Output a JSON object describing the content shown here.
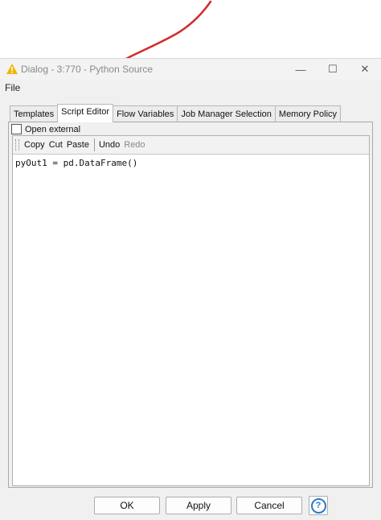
{
  "window": {
    "title": "Dialog - 3:770 - Python Source",
    "title_icon": "warning-triangle-icon",
    "controls": {
      "minimize": "—",
      "maximize": "☐",
      "close": "✕"
    }
  },
  "menu": {
    "file": "File"
  },
  "tabs": [
    {
      "label": "Templates",
      "active": false
    },
    {
      "label": "Script Editor",
      "active": true
    },
    {
      "label": "Flow Variables",
      "active": false
    },
    {
      "label": "Job Manager Selection",
      "active": false
    },
    {
      "label": "Memory Policy",
      "active": false
    }
  ],
  "editor": {
    "open_external_label": "Open external",
    "open_external_checked": false,
    "toolbar": {
      "copy": "Copy",
      "cut": "Cut",
      "paste": "Paste",
      "undo": "Undo",
      "redo": "Redo"
    },
    "code": "pyOut1 = pd.DataFrame()"
  },
  "buttons": {
    "ok": "OK",
    "apply": "Apply",
    "cancel": "Cancel",
    "help": "?"
  },
  "annotation": {
    "arrow_color": "#d42a2a"
  },
  "colors": {
    "warning_icon": "#f2b600",
    "help_blue": "#2d79c7"
  }
}
